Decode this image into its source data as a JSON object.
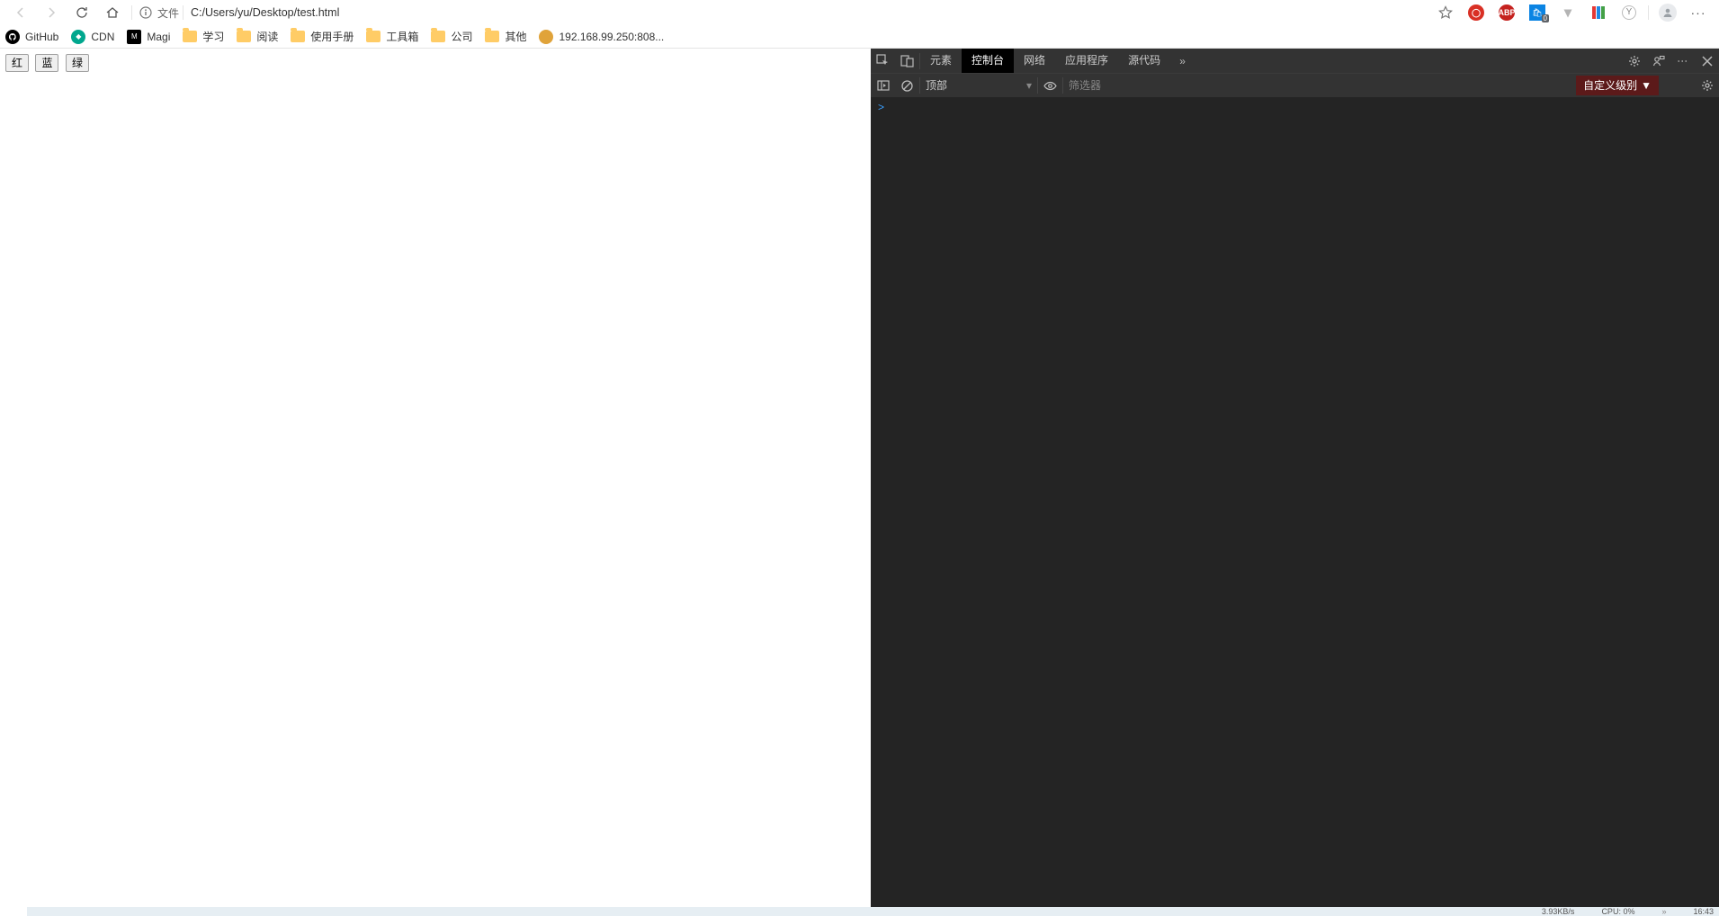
{
  "toolbar": {
    "file_label": "文件",
    "url": "C:/Users/yu/Desktop/test.html"
  },
  "bookmarks": [
    {
      "label": "GitHub",
      "type": "gh"
    },
    {
      "label": "CDN",
      "type": "cdn"
    },
    {
      "label": "Magi",
      "type": "magi"
    },
    {
      "label": "学习",
      "type": "folder"
    },
    {
      "label": "阅读",
      "type": "folder"
    },
    {
      "label": "使用手册",
      "type": "folder"
    },
    {
      "label": "工具箱",
      "type": "folder"
    },
    {
      "label": "公司",
      "type": "folder"
    },
    {
      "label": "其他",
      "type": "folder"
    },
    {
      "label": "192.168.99.250:808...",
      "type": "jenkins"
    }
  ],
  "page": {
    "buttons": [
      "红",
      "蓝",
      "绿"
    ]
  },
  "devtools": {
    "tabs": [
      "元素",
      "控制台",
      "网络",
      "应用程序",
      "源代码"
    ],
    "active_tab": "控制台",
    "context": "顶部",
    "filter_placeholder": "筛选器",
    "level": "自定义级别",
    "prompt": ">"
  },
  "ext": {
    "shopping_badge": "0"
  },
  "taskbar": {
    "net": "3.93KB/s",
    "cpu": "CPU: 0%",
    "time": "16:43"
  }
}
